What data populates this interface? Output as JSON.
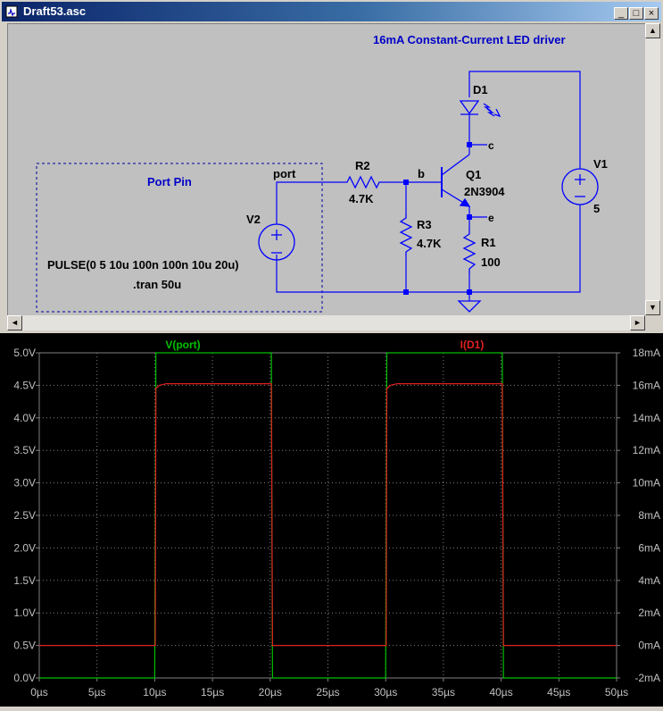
{
  "window": {
    "title": "Draft53.asc",
    "buttons": {
      "minimize": "_",
      "maximize": "□",
      "close": "×"
    }
  },
  "schematic": {
    "heading": "16mA Constant-Current LED driver",
    "port_pin_label": "Port Pin",
    "pulse_directive": "PULSE(0 5 10u 100n 100n 10u 20u)",
    "tran_directive": ".tran 50u",
    "net_port": "port",
    "net_b": "b",
    "net_c": "c",
    "net_e": "e",
    "components": {
      "D1": {
        "name": "D1"
      },
      "Q1": {
        "name": "Q1",
        "value": "2N3904"
      },
      "R1": {
        "name": "R1",
        "value": "100"
      },
      "R2": {
        "name": "R2",
        "value": "4.7K"
      },
      "R3": {
        "name": "R3",
        "value": "4.7K"
      },
      "V1": {
        "name": "V1",
        "value": "5"
      },
      "V2": {
        "name": "V2"
      }
    }
  },
  "scrollbars": {
    "left_arrow": "◄",
    "right_arrow": "►",
    "up_arrow": "▲",
    "down_arrow": "▼"
  },
  "chart_data": {
    "type": "line",
    "x_unit": "µs",
    "xlim": [
      0,
      50
    ],
    "x_ticks": [
      "0µs",
      "5µs",
      "10µs",
      "15µs",
      "20µs",
      "25µs",
      "30µs",
      "35µs",
      "40µs",
      "45µs",
      "50µs"
    ],
    "ylim_left": [
      0,
      5
    ],
    "y_ticks_left": [
      "5.0V",
      "4.5V",
      "4.0V",
      "3.5V",
      "3.0V",
      "2.5V",
      "2.0V",
      "1.5V",
      "1.0V",
      "0.5V",
      "0.0V"
    ],
    "ylim_right": [
      -2,
      18
    ],
    "y_ticks_right": [
      "18mA",
      "16mA",
      "14mA",
      "12mA",
      "10mA",
      "8mA",
      "6mA",
      "4mA",
      "2mA",
      "0mA",
      "-2mA"
    ],
    "grid": true,
    "series": [
      {
        "name": "V(port)",
        "color": "#00c000",
        "axis": "left",
        "x": [
          0,
          10,
          10.1,
          20.1,
          20.2,
          30,
          30.1,
          40.1,
          40.2,
          50
        ],
        "y": [
          0,
          0,
          5,
          5,
          0,
          0,
          5,
          5,
          0,
          0
        ]
      },
      {
        "name": "I(D1)",
        "color": "#e02020",
        "axis": "right",
        "x": [
          0,
          10.05,
          10.1,
          10.4,
          11,
          20.1,
          20.2,
          30.05,
          30.1,
          30.4,
          31,
          40.1,
          40.2,
          50
        ],
        "y": [
          0,
          0,
          15.8,
          16.0,
          16.1,
          16.1,
          0,
          0,
          15.8,
          16.0,
          16.1,
          16.1,
          0,
          0
        ]
      }
    ]
  }
}
